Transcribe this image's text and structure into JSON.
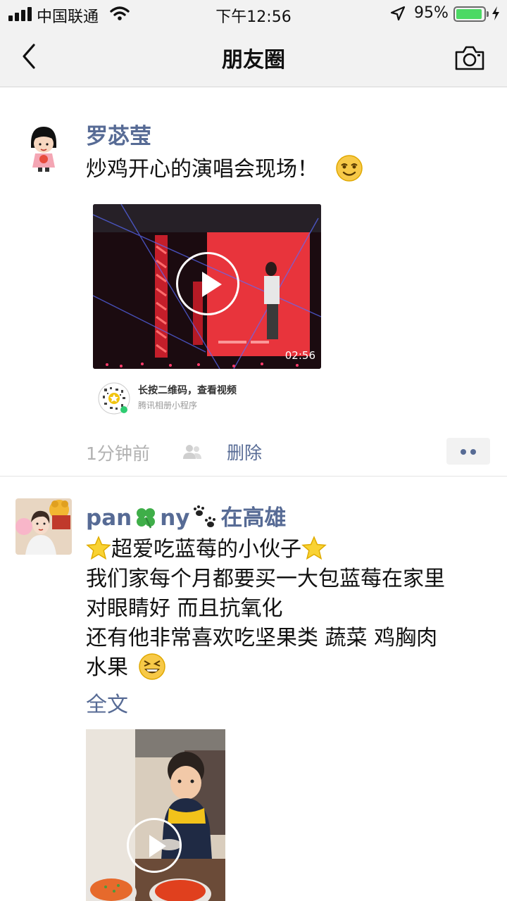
{
  "status_bar": {
    "carrier": "中国联通",
    "time": "下午12:56",
    "battery_percent": "95%",
    "battery_level": 0.95,
    "battery_color": "#4cd964"
  },
  "nav": {
    "back_icon": "chevron-left-icon",
    "title": "朋友圈",
    "camera_icon": "camera-icon"
  },
  "colors": {
    "link": "#576b95",
    "muted": "#b2b2b2",
    "nav_bg": "#f2f2f2"
  },
  "posts": [
    {
      "author": "罗苾莹",
      "text": "炒鸡开心的演唱会现场！",
      "text_emoji": "smirking-face-icon",
      "video": {
        "duration": "02:56",
        "play_icon": "play-icon"
      },
      "qr": {
        "title": "长按二维码，查看视频",
        "subtitle": "腾讯相册小程序"
      },
      "time": "1分钟前",
      "visibility_icon": "people-icon",
      "delete_label": "删除",
      "more_icon": "more-dots-icon"
    },
    {
      "author_parts": [
        "pan",
        "ny",
        "在高雄"
      ],
      "author_icons": [
        "four-leaf-clover-icon",
        "paw-prints-icon"
      ],
      "lines": [
        "超爱吃蓝莓的小伙子",
        "我们家每个月都要买一大包蓝莓在家里",
        "对眼睛好 而且抗氧化",
        "还有他非常喜欢吃坚果类 蔬菜 鸡胸肉",
        "水果"
      ],
      "line_icons": [
        "star-icon",
        "grinning-squinting-face-icon"
      ],
      "full_text_label": "全文",
      "video": {
        "play_icon": "play-icon"
      }
    }
  ]
}
